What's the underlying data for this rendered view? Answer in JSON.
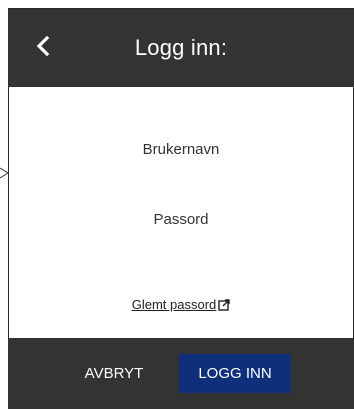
{
  "header": {
    "title": "Logg inn:",
    "back_icon": "chevron-left-icon"
  },
  "form": {
    "username_label": "Brukernavn",
    "password_label": "Passord",
    "forgot_link": "Glemt passord",
    "forgot_icon": "external-link-icon"
  },
  "footer": {
    "cancel_label": "AVBRYT",
    "login_label": "LOGG INN"
  },
  "colors": {
    "header_bg": "#333333",
    "footer_bg": "#333333",
    "primary_button": "#0f2f7a"
  }
}
